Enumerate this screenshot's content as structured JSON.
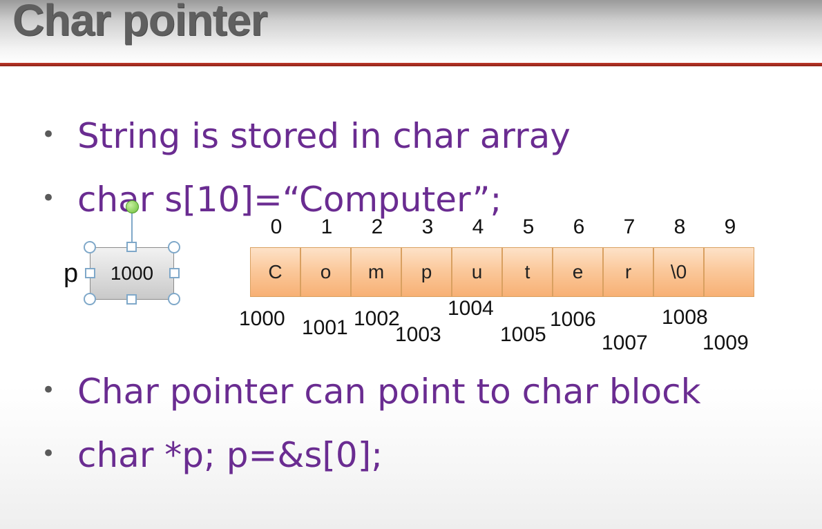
{
  "slide": {
    "title": "Char pointer",
    "bullets": [
      "String is stored in char array",
      "char s[10]=“Computer”;",
      "Char pointer can point to char block",
      "char *p; p=&s[0];"
    ],
    "bullet_symbol": "•"
  },
  "array": {
    "indices": [
      "0",
      "1",
      "2",
      "3",
      "4",
      "5",
      "6",
      "7",
      "8",
      "9"
    ],
    "cells": [
      "C",
      "o",
      "m",
      "p",
      "u",
      "t",
      "e",
      "r",
      "\\0",
      ""
    ],
    "addresses": [
      "1000",
      "1001",
      "1002",
      "1003",
      "1004",
      "1005",
      "1006",
      "1007",
      "1008",
      "1009"
    ]
  },
  "pointer": {
    "name": "p",
    "value": "1000"
  },
  "colors": {
    "title_text": "#5f5f5f",
    "title_rule": "#c0392b",
    "bullet_text": "#6a2c91",
    "cell_fill": "#fbc99c",
    "cell_border": "#d9a060",
    "selection_handle": "#7fa8c9",
    "rotation_handle": "#6cbf3a"
  }
}
